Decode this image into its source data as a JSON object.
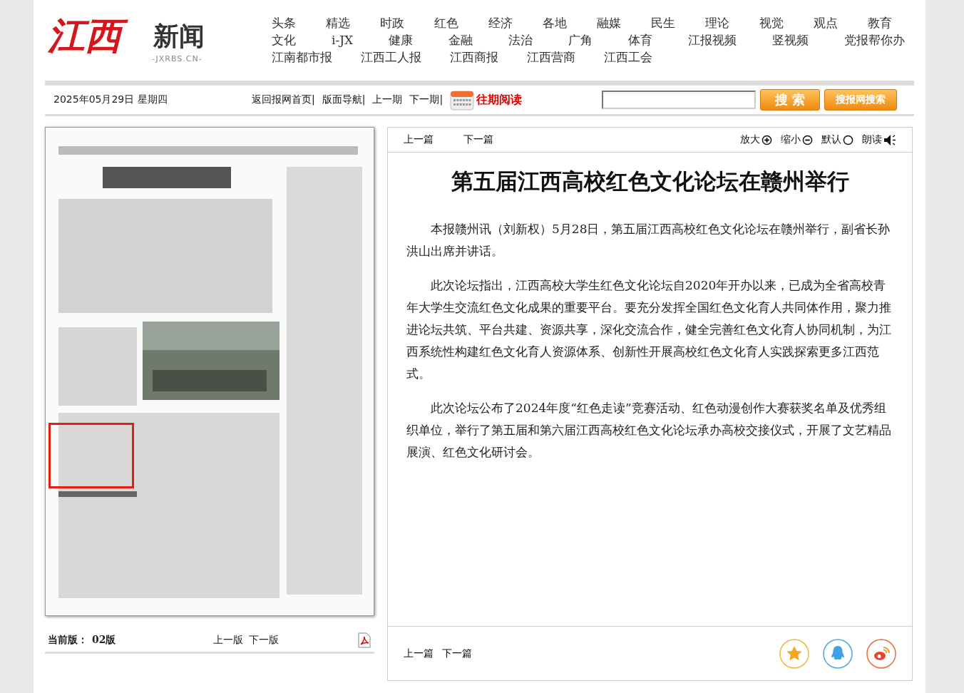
{
  "logo": {
    "red_text": "江西",
    "black_text": "新闻",
    "domain": "-JXRBS.CN-"
  },
  "nav": {
    "channels": [
      "头条",
      "精选",
      "时政",
      "红色",
      "经济",
      "各地",
      "融媒",
      "民生",
      "理论",
      "视觉",
      "观点",
      "教育"
    ],
    "more_channels": [
      "文化",
      "i-JX",
      "健康",
      "金融",
      "法治",
      "广角",
      "体育",
      "江报视频",
      "竖视频",
      "党报帮你办"
    ],
    "papers": [
      "江南都市报",
      "江西工人报",
      "江西商报",
      "江西营商",
      "江西工会"
    ]
  },
  "toolbar": {
    "date": "2025年05月29日 星期四",
    "links": [
      "返回报网首页|",
      "版面导航|",
      "上一期",
      "下一期|"
    ],
    "archive": "往期阅读",
    "search_button": "搜 索",
    "site_search_button": "搜报网搜索"
  },
  "page_view": {
    "current_label": "当前版：",
    "current_value": "02版",
    "prev": "上一版",
    "next": "下一版"
  },
  "article": {
    "top_nav": [
      "上一篇",
      "下一篇"
    ],
    "tools": [
      {
        "kind": "zoom-in",
        "label": "放大"
      },
      {
        "kind": "zoom-out",
        "label": "缩小"
      },
      {
        "kind": "default",
        "label": "默认"
      },
      {
        "kind": "read",
        "label": "朗读"
      }
    ],
    "title": "第五届江西高校红色文化论坛在赣州举行",
    "paragraphs": [
      "本报赣州讯（刘新权）5月28日，第五届江西高校红色文化论坛在赣州举行，副省长孙洪山出席并讲话。",
      "此次论坛指出，江西高校大学生红色文化论坛自2020年开办以来，已成为全省高校青年大学生交流红色文化成果的重要平台。要充分发挥全国红色文化育人共同体作用，聚力推进论坛共筑、平台共建、资源共享，深化交流合作，健全完善红色文化育人协同机制，为江西系统性构建红色文化育人资源体系、创新性开展高校红色文化育人实践探索更多江西范式。",
      "此次论坛公布了2024年度“红色走读”竞赛活动、红色动漫创作大赛获奖名单及优秀组织单位，举行了第五届和第六届江西高校红色文化论坛承办高校交接仪式，开展了文艺精品展演、红色文化研讨会。"
    ],
    "bottom_nav": [
      "上一篇",
      "下一篇"
    ],
    "share": [
      {
        "kind": "favorite"
      },
      {
        "kind": "qq"
      },
      {
        "kind": "weibo"
      }
    ]
  }
}
